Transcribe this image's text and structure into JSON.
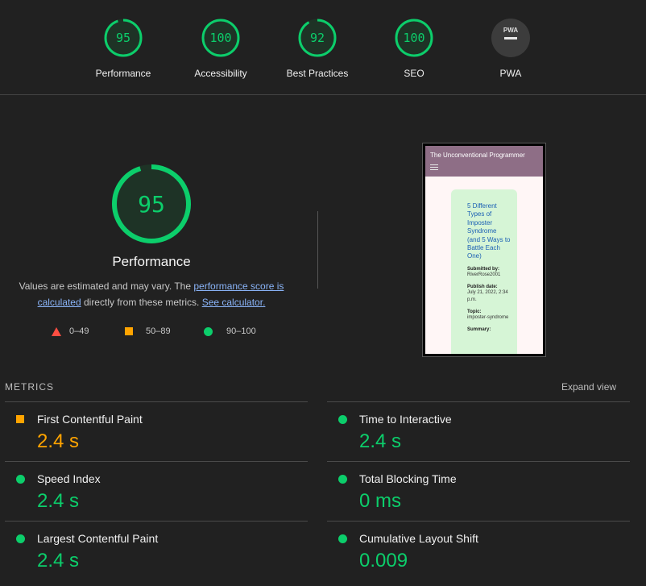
{
  "categories": [
    {
      "label": "Performance",
      "score": "95"
    },
    {
      "label": "Accessibility",
      "score": "100"
    },
    {
      "label": "Best Practices",
      "score": "92"
    },
    {
      "label": "SEO",
      "score": "100"
    },
    {
      "label": "PWA",
      "badge": "PWA"
    }
  ],
  "performance": {
    "score": "95",
    "title": "Performance",
    "desc_pre": "Values are estimated and may vary. The ",
    "link1": "performance score is calculated",
    "desc_mid": " directly from these metrics. ",
    "link2": "See calculator."
  },
  "legend": {
    "fail": "0–49",
    "average": "50–89",
    "pass": "90–100"
  },
  "screenshot": {
    "site_title": "The Unconventional Programmer",
    "card_title": "5 Different Types of Imposter Syndrome (and 5 Ways to Battle Each One)",
    "submitted_label": "Submitted by:",
    "submitted_value": "RiverRose2001",
    "publish_label": "Publish date:",
    "publish_value": "July 21, 2022, 2:34 p.m.",
    "topic_label": "Topic:",
    "topic_value": "imposter-syndrome",
    "summary_label": "Summary:"
  },
  "metrics_header": "METRICS",
  "expand_view": "Expand view",
  "metrics": [
    {
      "name": "First Contentful Paint",
      "value": "2.4 s",
      "rating": "orange"
    },
    {
      "name": "Time to Interactive",
      "value": "2.4 s",
      "rating": "green"
    },
    {
      "name": "Speed Index",
      "value": "2.4 s",
      "rating": "green"
    },
    {
      "name": "Total Blocking Time",
      "value": "0 ms",
      "rating": "green"
    },
    {
      "name": "Largest Contentful Paint",
      "value": "2.4 s",
      "rating": "green"
    },
    {
      "name": "Cumulative Layout Shift",
      "value": "0.009",
      "rating": "green"
    }
  ],
  "colors": {
    "pass": "#0cce6b",
    "average": "#ffa400",
    "fail": "#ff4e42"
  }
}
